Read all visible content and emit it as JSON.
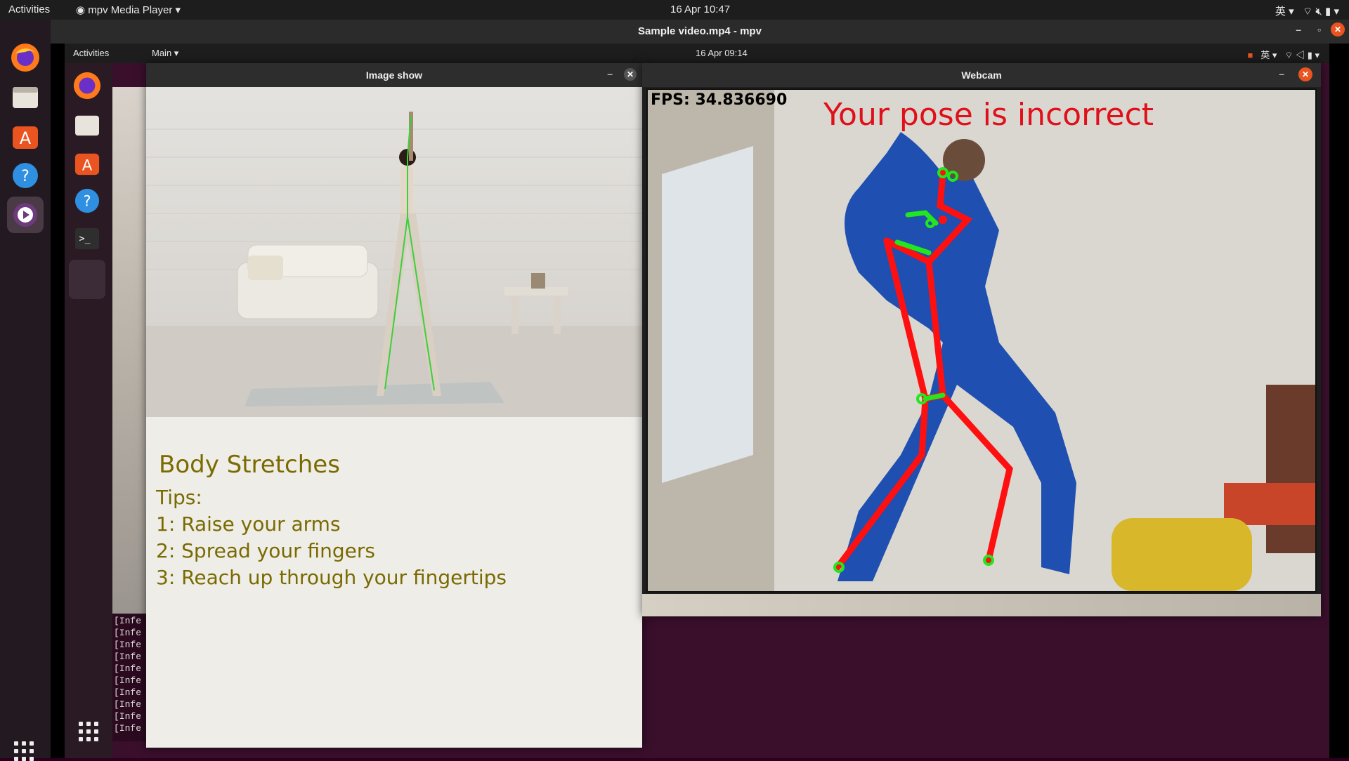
{
  "outer_top": {
    "activities": "Activities",
    "app_menu": "mpv Media Player",
    "clock": "16 Apr  10:47",
    "lang": "英"
  },
  "mpv": {
    "title": "Sample video.mp4 - mpv"
  },
  "inner_top": {
    "activities": "Activities",
    "menu": "Main",
    "clock": "16 Apr  09:14",
    "lang": "英"
  },
  "terminal": {
    "lines": [
      "[Infe",
      "[Infe",
      "[Infe",
      "[Infe",
      "[Infe",
      "[Infe",
      "[Infe",
      "[Infe",
      "[Infe",
      "[Infe"
    ]
  },
  "image_show": {
    "title": "Image show",
    "heading": "Body Stretches",
    "tips_label": "Tips:",
    "tips": [
      "1: Raise your arms",
      "2: Spread your fingers",
      "3: Reach up through your fingertips"
    ]
  },
  "webcam": {
    "title": "Webcam",
    "fps": "FPS: 34.836690",
    "status": "Your pose is incorrect"
  },
  "colors": {
    "ubuntu_orange": "#e95420",
    "pose_ok": "#22e61e",
    "pose_bad": "#ff1010",
    "tip_text": "#7a6a00"
  }
}
